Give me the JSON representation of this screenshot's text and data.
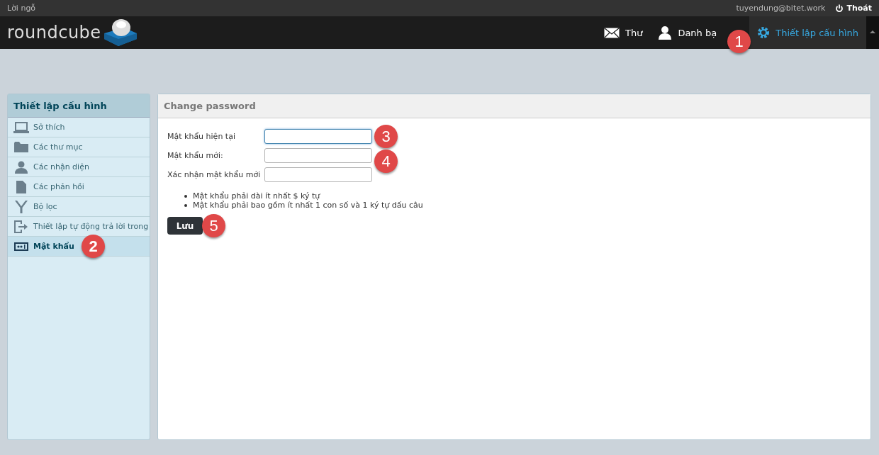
{
  "topbar": {
    "about": "Lời ngỗ",
    "user": "tuyendung@bitet.work",
    "logout": "Thoát"
  },
  "header": {
    "logo": "roundcube",
    "nav": [
      {
        "label": "Thư",
        "kind": "mail",
        "selected": false
      },
      {
        "label": "Danh bạ",
        "kind": "contacts",
        "selected": false
      },
      {
        "label": "Thiết lập cấu hình",
        "kind": "settings",
        "selected": true,
        "callout": "1"
      }
    ]
  },
  "sidebar": {
    "title": "Thiết lập cấu hình",
    "items": [
      {
        "label": "Sở thích",
        "kind": "laptop",
        "selected": false
      },
      {
        "label": "Các thư mục",
        "kind": "folder",
        "selected": false
      },
      {
        "label": "Các nhận diện",
        "kind": "person",
        "selected": false
      },
      {
        "label": "Các phản hồi",
        "kind": "document",
        "selected": false
      },
      {
        "label": "Bộ lọc",
        "kind": "filter",
        "selected": false
      },
      {
        "label": "Thiết lập tự động trả lời trong",
        "kind": "exit",
        "selected": false
      },
      {
        "label": "Mật khẩu",
        "kind": "password",
        "selected": true,
        "callout": "2"
      }
    ]
  },
  "panel": {
    "title": "Change password",
    "fields": [
      {
        "label": "Mật khẩu hiện tại",
        "focused": true,
        "callout": "3"
      },
      {
        "label": "Mật khẩu mới:",
        "focused": false,
        "callout": "4"
      },
      {
        "label": "Xác nhận mật khẩu mới",
        "focused": false
      }
    ],
    "rules": [
      "Mật khẩu phải dài ít nhất $ ký tự",
      "Mật khẩu phải bao gồm ít nhất 1 con số và 1 ký tự dấu câu"
    ],
    "save_button": {
      "label": "Lưu",
      "callout": "5"
    }
  }
}
